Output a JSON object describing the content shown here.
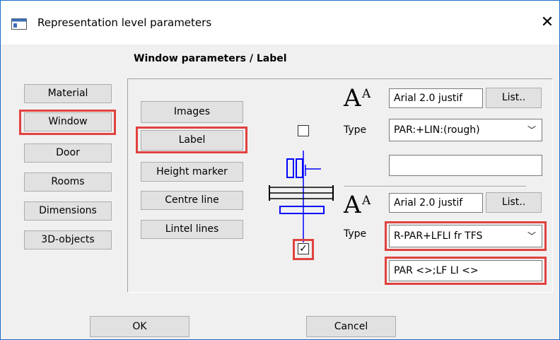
{
  "window": {
    "title": "Representation level parameters"
  },
  "heading": "Window parameters / Label",
  "categories": [
    "Material",
    "Window",
    "Door",
    "Rooms",
    "Dimensions",
    "3D-objects"
  ],
  "sub_options": [
    "Images",
    "Label",
    "Height marker",
    "Centre line",
    "Lintel lines"
  ],
  "font_upper": {
    "value": "Arial 2.0 justif",
    "list_label": "List..",
    "type_label": "Type",
    "type_value": "PAR:+LIN:(rough)",
    "text_value": ""
  },
  "font_lower": {
    "value": "Arial 2.0 justif",
    "list_label": "List..",
    "type_label": "Type",
    "type_value": "R-PAR+LFLI fr TFS",
    "text_value": "PAR <>;LF LI <>"
  },
  "checkbox_top": {
    "checked": false
  },
  "checkbox_bottom": {
    "checked": true,
    "mark": "✓"
  },
  "buttons": {
    "ok": "OK",
    "cancel": "Cancel"
  },
  "colors": {
    "highlight": "#e0423f",
    "symbol_blue": "#0000ff"
  }
}
